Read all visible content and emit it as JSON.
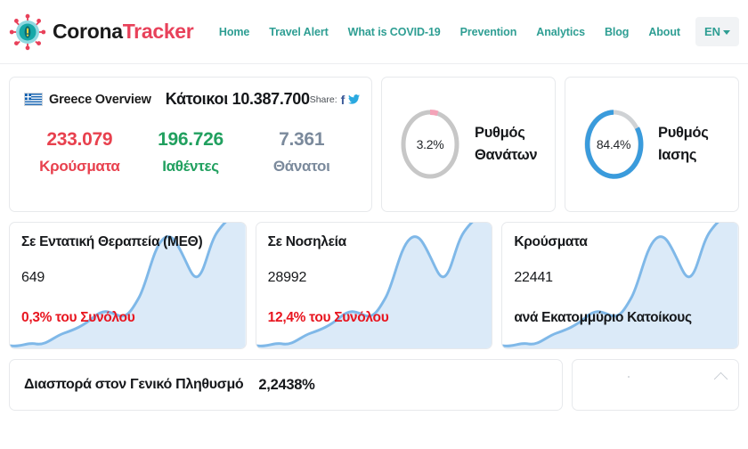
{
  "header": {
    "brand": {
      "part1": "Corona",
      "part2": "Tracker",
      "logo_icon": "virus-icon"
    },
    "nav": [
      {
        "label": "Home"
      },
      {
        "label": "Travel Alert"
      },
      {
        "label": "What is COVID-19"
      },
      {
        "label": "Prevention"
      },
      {
        "label": "Analytics"
      },
      {
        "label": "Blog"
      },
      {
        "label": "About"
      }
    ],
    "language": {
      "label": "EN",
      "icon": "chevron-down-icon"
    }
  },
  "overview": {
    "flag_icon": "greece-flag-icon",
    "title": "Greece Overview",
    "population_label": "Κάτοικοι 10.387.700",
    "share_label": "Share:",
    "share_icons": [
      {
        "name": "facebook-icon",
        "glyph": "f"
      },
      {
        "name": "twitter-icon",
        "glyph": "🐦"
      }
    ],
    "stats": [
      {
        "value": "233.079",
        "label": "Κρούσματα",
        "color": "#e8414e"
      },
      {
        "value": "196.726",
        "label": "Ιαθέντες",
        "color": "#21a05f"
      },
      {
        "value": "7.361",
        "label": "Θάνατοι",
        "color": "#7b8a9c"
      }
    ]
  },
  "donuts": [
    {
      "percent_text": "3.2%",
      "percent_value": 3.2,
      "label_line1": "Ρυθμός",
      "label_line2": "Θανάτων",
      "arc_color": "#f4a3b8",
      "track_color": "#c7c7c7"
    },
    {
      "percent_text": "84.4%",
      "percent_value": 84.4,
      "label_line1": "Ρυθμός",
      "label_line2": "Ιασης",
      "arc_color": "#3a9bdc",
      "track_color": "#cfd2d5"
    }
  ],
  "spark_cards": [
    {
      "title": "Σε Εντατική Θεραπεία (ΜΕΘ)",
      "value": "649",
      "sub": "0,3% του Συνόλου",
      "sub_style": "red"
    },
    {
      "title": "Σε Νοσηλεία",
      "value": "28992",
      "sub": "12,4% του Συνόλου",
      "sub_style": "red"
    },
    {
      "title": "Κρούσματα",
      "value": "22441",
      "sub": "ανά Εκατομμύριο Κατοίκους",
      "sub_style": "dark"
    }
  ],
  "spread": {
    "title": "Διασπορά στον Γενικό Πληθυσμό",
    "value": "2,2438%"
  },
  "mini_card": {
    "icon": "chevron-up-icon"
  },
  "chart_data": {
    "type": "area",
    "title": "",
    "xlabel": "",
    "ylabel": "",
    "grid": false,
    "legend": "none",
    "line_color": "#7fb8e8",
    "fill_color": "#dbeaf8",
    "x": [
      0,
      1,
      2,
      3,
      4,
      5,
      6,
      7,
      8,
      9,
      10,
      11,
      12,
      13,
      14,
      15,
      16,
      17,
      18,
      19,
      20,
      21,
      22
    ],
    "series": [
      {
        "name": "trend",
        "values": [
          8,
          6,
          10,
          14,
          13,
          16,
          20,
          24,
          30,
          26,
          22,
          24,
          34,
          52,
          72,
          66,
          52,
          44,
          62,
          84,
          96,
          100,
          112
        ]
      }
    ]
  }
}
